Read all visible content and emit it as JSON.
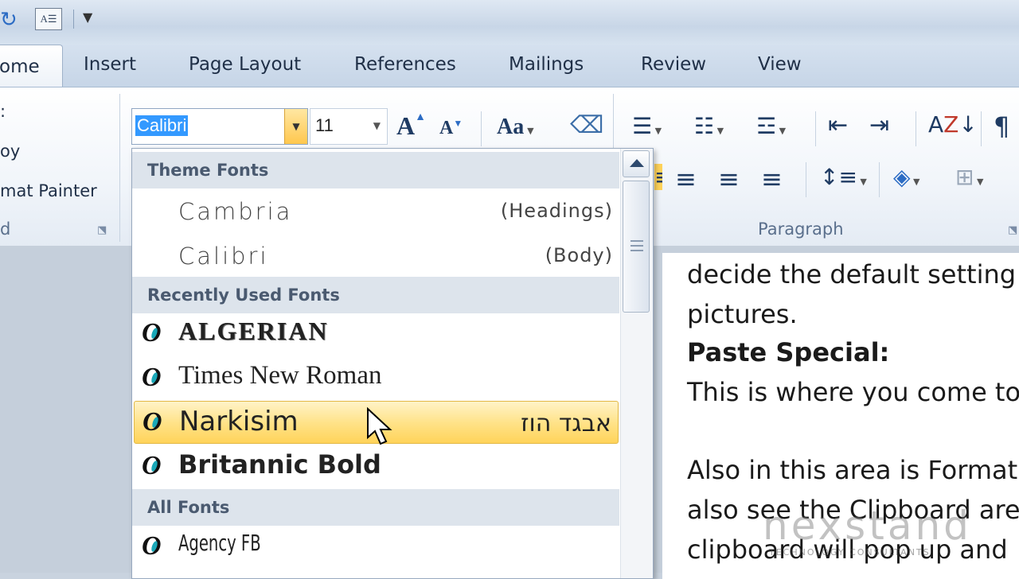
{
  "quick_access": {
    "redo_icon": "redo-icon",
    "doc_icon": "document-icon",
    "customize_icon": "customize-qat-icon"
  },
  "tabs": [
    {
      "label": "ome",
      "active": true
    },
    {
      "label": "Insert"
    },
    {
      "label": "Page Layout"
    },
    {
      "label": "References"
    },
    {
      "label": "Mailings"
    },
    {
      "label": "Review"
    },
    {
      "label": "View"
    }
  ],
  "clipboard": {
    "cut_fragment": ":",
    "copy_fragment": "oy",
    "format_painter": "mat Painter",
    "group_label": "d"
  },
  "font_group": {
    "font_name": "Calibri",
    "font_size": "11",
    "grow_icon": "grow-font-icon",
    "shrink_icon": "shrink-font-icon",
    "change_case": "Aa",
    "clear_formatting_icon": "clear-formatting-icon"
  },
  "paragraph": {
    "group_label": "Paragraph",
    "pilcrow": "¶"
  },
  "font_dropdown": {
    "theme_header": "Theme Fonts",
    "theme_fonts": [
      {
        "name": "Cambria",
        "tag": "(Headings)"
      },
      {
        "name": "Calibri",
        "tag": "(Body)"
      }
    ],
    "recent_header": "Recently Used Fonts",
    "recent_fonts": [
      {
        "name": "ALGERIAN",
        "sample": ""
      },
      {
        "name": "Times New Roman",
        "sample": ""
      },
      {
        "name": "Narkisim",
        "sample": "אבגד הוז",
        "highlighted": true
      },
      {
        "name": "Britannic Bold",
        "sample": ""
      }
    ],
    "all_header": "All Fonts",
    "all_fonts": [
      {
        "name": "Agency FB"
      }
    ]
  },
  "document": {
    "lines": [
      {
        "text": "decide the default setting",
        "bold": false
      },
      {
        "text": "pictures.",
        "bold": false
      },
      {
        "text": "Paste Special:",
        "bold": true
      },
      {
        "text": "This is where you come to",
        "bold": false
      },
      {
        "text": "Also in this area is Format",
        "bold": false
      },
      {
        "text": "also see the Clipboard are",
        "bold": false
      },
      {
        "text": "clipboard will pop up and",
        "bold": false
      }
    ]
  },
  "watermark": {
    "brand": "nexstand",
    "tagline": "TECHNOLOGY CONSULTANTS"
  },
  "colors": {
    "highlight": "#ffe38a",
    "selection": "#3399ff",
    "accent": "#2c6cc4"
  }
}
